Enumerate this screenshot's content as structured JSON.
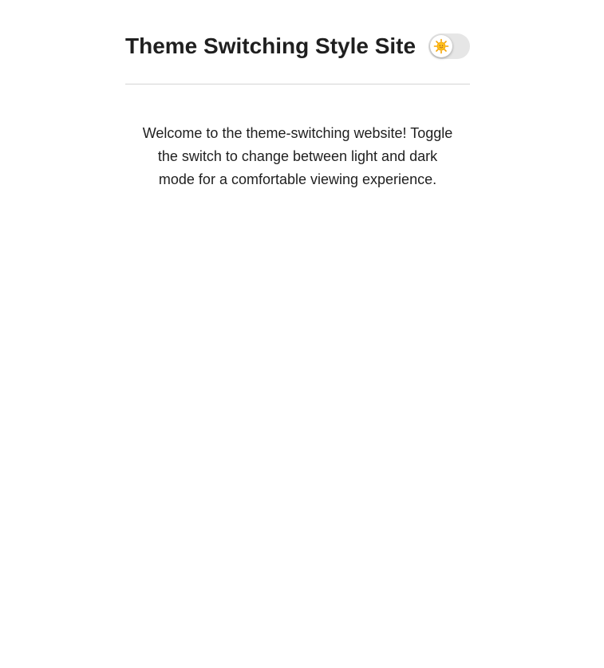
{
  "header": {
    "title": "Theme Switching Style Site",
    "toggle": {
      "state": "light",
      "icon": "sun-icon"
    }
  },
  "main": {
    "intro": "Welcome to the theme-switching website! Toggle the switch to change between light and dark mode for a comfortable viewing experience."
  },
  "colors": {
    "text": "#1f1f1f",
    "background": "#ffffff",
    "divider": "#d4d4d4",
    "toggle_track": "#e6e6e6",
    "sun": "#f5b400"
  }
}
